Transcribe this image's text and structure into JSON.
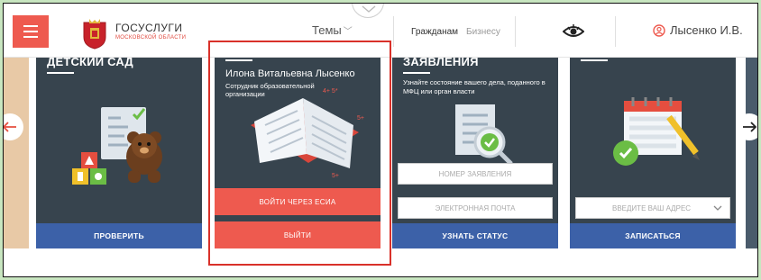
{
  "header": {
    "brand_title": "ГОСУСЛУГИ",
    "brand_subtitle": "МОСКОВСКОЙ ОБЛАСТИ",
    "themes_label": "Темы",
    "nav_citizens": "Гражданам",
    "nav_business": "Бизнесу",
    "user_name": "Лысенко И.В.",
    "accent_color": "#ee5a4f"
  },
  "cards": [
    {
      "title": "ДЕТСКИЙ САД",
      "button": "ПРОВЕРИТЬ"
    },
    {
      "person_name": "Илона Витальевна Лысенко",
      "person_role": "Сотрудник образовательной организации",
      "login_button": "ВОЙТИ ЧЕРЕЗ ЕСИА",
      "logout_button": "ВЫЙТИ"
    },
    {
      "title": "ЗАЯВЛЕНИЯ",
      "description": "Узнайте состояние вашего дела, поданного в МФЦ или орган власти",
      "field_number": "НОМЕР ЗАЯВЛЕНИЯ",
      "field_email": "ЭЛЕКТРОННАЯ ПОЧТА",
      "button": "УЗНАТЬ СТАТУС"
    },
    {
      "address_placeholder": "ВВЕДИТЕ ВАШ АДРЕС",
      "button": "ЗАПИСАТЬСЯ"
    }
  ],
  "colors": {
    "card_bg": "#37444e",
    "card_button": "#3c61a8",
    "highlight_border": "#d9312a"
  }
}
